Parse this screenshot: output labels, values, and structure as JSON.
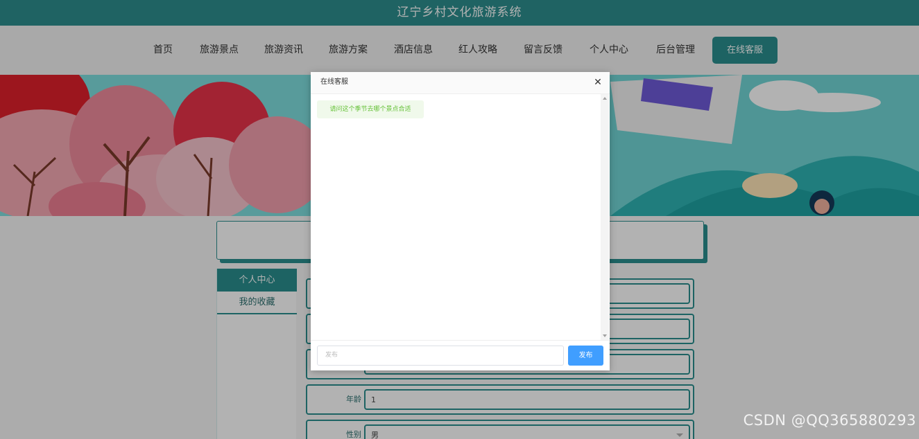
{
  "site": {
    "title": "辽宁乡村文化旅游系统"
  },
  "nav": {
    "items": [
      "首页",
      "旅游景点",
      "旅游资讯",
      "旅游方案",
      "酒店信息",
      "红人攻略",
      "留言反馈",
      "个人中心",
      "后台管理"
    ],
    "service_button": "在线客服"
  },
  "side_menu": {
    "active": "个人中心",
    "items": [
      "我的收藏"
    ]
  },
  "form": {
    "age_label": "年龄",
    "age_value": "1",
    "gender_label": "性别",
    "gender_value": "男"
  },
  "dialog": {
    "title": "在线客服",
    "close_icon": "close-icon",
    "messages": [
      "请问这个季节去哪个景点合适"
    ],
    "input_placeholder": "发布",
    "send_label": "发布"
  },
  "watermark": "CSDN @QQ365880293",
  "colors": {
    "primary": "#2a8f8f",
    "send_button": "#409eff",
    "message_bg": "#f0f9eb",
    "message_text": "#67c23a"
  }
}
